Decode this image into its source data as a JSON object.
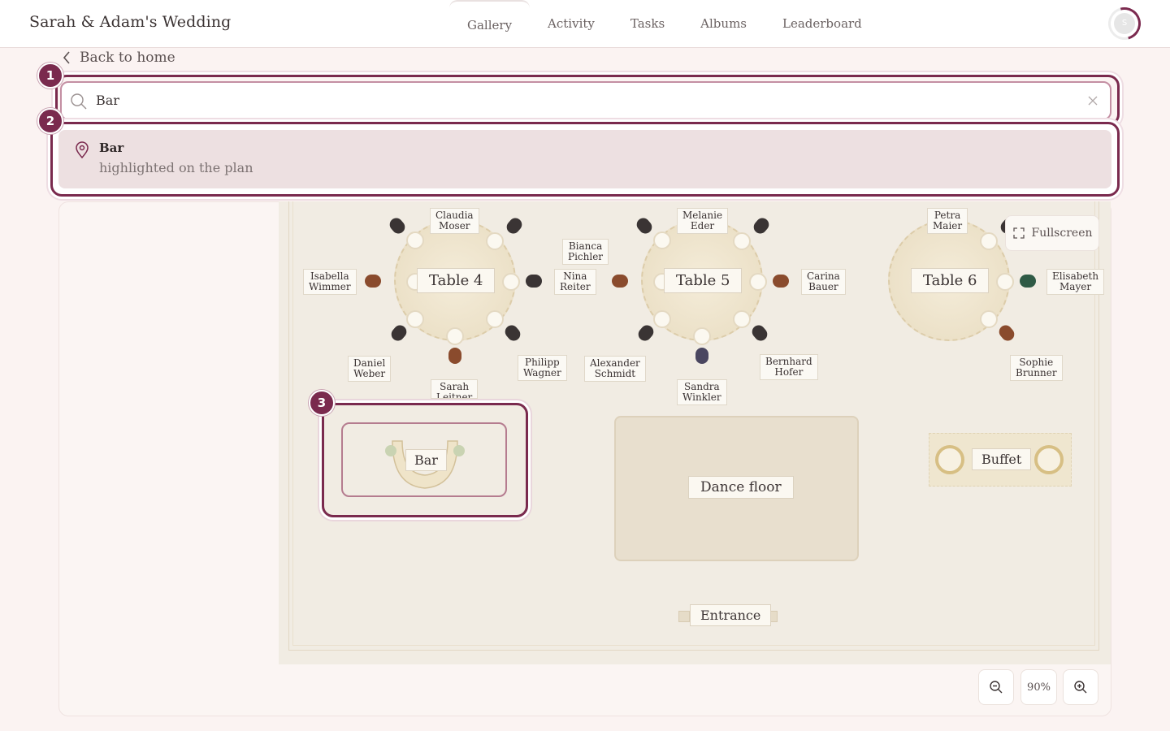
{
  "header": {
    "title": "Sarah & Adam's Wedding",
    "nav": [
      "Gallery",
      "Activity",
      "Tasks",
      "Albums",
      "Leaderboard"
    ],
    "avatar_initial": "S"
  },
  "back_label": "Back to home",
  "search": {
    "value": "Bar",
    "result_title": "Bar",
    "result_subtitle": "highlighted on the plan"
  },
  "badges": [
    "1",
    "2",
    "3"
  ],
  "plan": {
    "tables": [
      {
        "label": "Table 4"
      },
      {
        "label": "Table 5"
      },
      {
        "label": "Table 6"
      }
    ],
    "guests": {
      "t4_top": "Claudia\nMoser",
      "t4_left": "Isabella\nWimmer",
      "t4_right": "Nina\nReiter",
      "t4_bl": "Daniel\nWeber",
      "t4_br": "Philipp\nWagner",
      "t4_bottom": "Sarah\nLeitner",
      "t5_top": "Melanie\nEder",
      "t5_tl": "Bianca\nPichler",
      "t5_right": "Carina\nBauer",
      "t5_bl": "Alexander\nSchmidt",
      "t5_br": "Bernhard\nHofer",
      "t5_bottom": "Sandra\nWinkler",
      "t6_top": "Petra\nMaier",
      "t6_right": "Elisabeth\nMayer",
      "t6_br": "Sophie\nBrunner"
    },
    "areas": {
      "bar": "Bar",
      "dance_floor": "Dance floor",
      "buffet": "Buffet",
      "entrance": "Entrance"
    }
  },
  "controls": {
    "fullscreen": "Fullscreen",
    "zoom": "90%"
  },
  "colors": {
    "accent": "#7a2a4e",
    "background": "#fbf3f2",
    "plan": "#f1ece3"
  }
}
